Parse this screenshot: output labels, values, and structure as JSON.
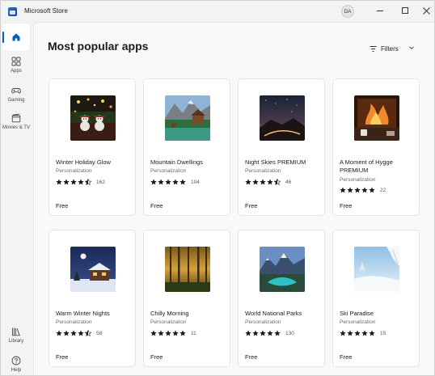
{
  "window": {
    "title": "Microsoft Store",
    "user_initials": "DA"
  },
  "sidebar": {
    "items": [
      {
        "label": "",
        "icon": "home-icon"
      },
      {
        "label": "Apps",
        "icon": "apps-icon"
      },
      {
        "label": "Gaming",
        "icon": "gamepad-icon"
      },
      {
        "label": "Movies & TV",
        "icon": "film-icon"
      },
      {
        "label": "Library",
        "icon": "library-icon"
      },
      {
        "label": "Help",
        "icon": "help-icon"
      }
    ]
  },
  "main": {
    "title": "Most popular apps",
    "filters_label": "Filters"
  },
  "cards": [
    {
      "name": "Winter Holiday Glow",
      "category": "Personalization",
      "rating": 4.5,
      "count": "162",
      "price": "Free"
    },
    {
      "name": "Mountain Dwellings",
      "category": "Personalization",
      "rating": 5,
      "count": "104",
      "price": "Free"
    },
    {
      "name": "Night Skies PREMIUM",
      "category": "Personalization",
      "rating": 4.5,
      "count": "46",
      "price": "Free"
    },
    {
      "name": "A Moment of Hygge PREMIUM",
      "category": "Personalization",
      "rating": 5,
      "count": "22",
      "price": "Free"
    },
    {
      "name": "Warm Winter Nights",
      "category": "Personalization",
      "rating": 4.5,
      "count": "58",
      "price": "Free"
    },
    {
      "name": "Chilly Morning",
      "category": "Personalization",
      "rating": 5,
      "count": "11",
      "price": "Free"
    },
    {
      "name": "World National Parks",
      "category": "Personalization",
      "rating": 5,
      "count": "130",
      "price": "Free"
    },
    {
      "name": "Ski Paradise",
      "category": "Personalization",
      "rating": 5,
      "count": "15",
      "price": "Free"
    }
  ],
  "colors": {
    "accent": "#005fb8",
    "star": "#1b1b1b"
  }
}
